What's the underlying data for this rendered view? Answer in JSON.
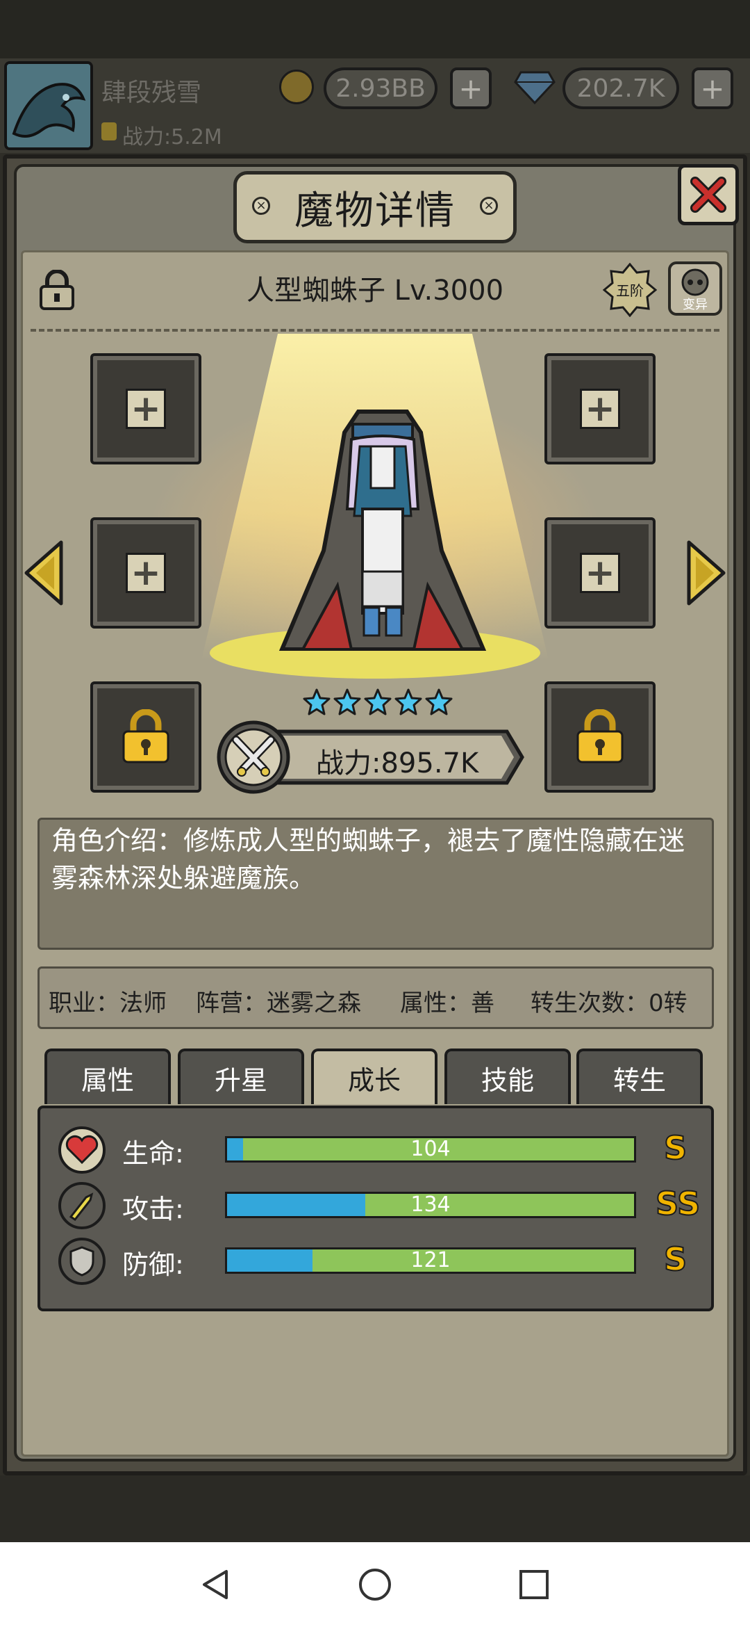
{
  "header": {
    "player_name": "肆段残雪",
    "power": "战力:5.2M",
    "gold": "2.93BB",
    "gems": "202.7K",
    "plus": "+"
  },
  "panel": {
    "title": "魔物详情",
    "monster_name": "人型蜘蛛子 Lv.3000",
    "rank_badge": "五阶",
    "mutate_badge": "变异",
    "stars": 5,
    "power": "战力:895.7K",
    "intro": "角色介绍：修炼成人型的蜘蛛子，褪去了魔性隐藏在迷雾森林深处躲避魔族。",
    "info": {
      "job": "职业：法师",
      "camp": "阵营：迷雾之森",
      "attr": "属性：善",
      "rebirth": "转生次数：0转"
    },
    "tabs": [
      {
        "label": "属性",
        "active": false
      },
      {
        "label": "升星",
        "active": false
      },
      {
        "label": "成长",
        "active": true
      },
      {
        "label": "技能",
        "active": false
      },
      {
        "label": "转生",
        "active": false
      }
    ],
    "growth": [
      {
        "label": "生命:",
        "value": "104",
        "fill": 0.04,
        "grade": "S",
        "icon": "heart-icon",
        "color": "#d83a3a"
      },
      {
        "label": "攻击:",
        "value": "134",
        "fill": 0.34,
        "grade": "SS",
        "icon": "sword-icon",
        "color": "#e8d84a"
      },
      {
        "label": "防御:",
        "value": "121",
        "fill": 0.21,
        "grade": "S",
        "icon": "shield-icon",
        "color": "#9a9890"
      }
    ]
  },
  "colors": {
    "bar_green": "#8ec55a",
    "bar_blue": "#33a7db",
    "grade_gold": "#f0b400"
  }
}
